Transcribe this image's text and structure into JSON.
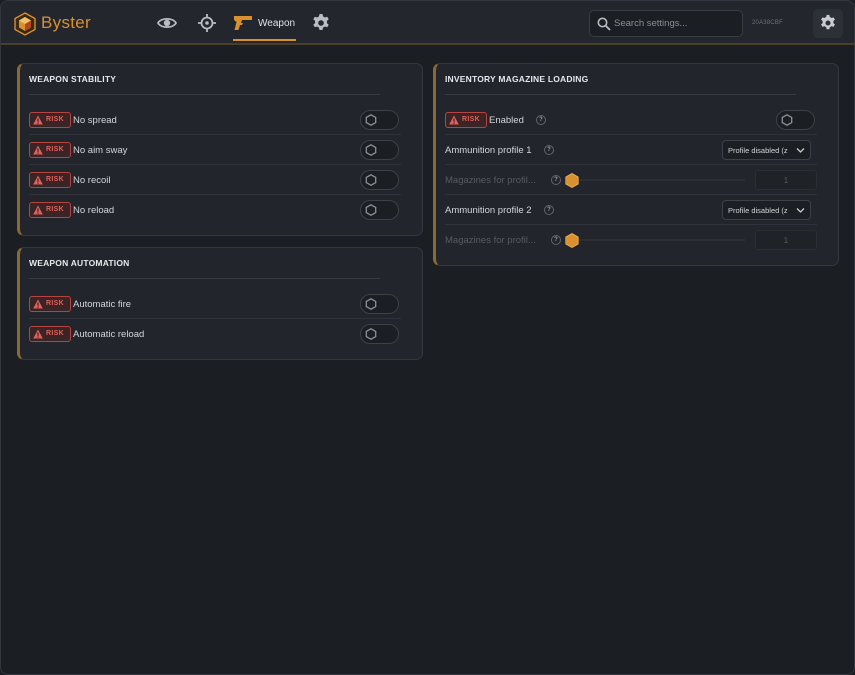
{
  "app": {
    "brand": "Byster",
    "session_code": "20A38CBF"
  },
  "nav": {
    "weapon_label": "Weapon",
    "items": [
      "visuals-eye-icon",
      "aim-crosshair-icon",
      "weapon-pistol-icon",
      "settings-gear-icon"
    ],
    "active": "Weapon"
  },
  "search": {
    "placeholder": "Search settings...",
    "value": ""
  },
  "colors": {
    "accent": "#d9902f",
    "risk": "#e0605a",
    "panel_bg": "#22252b",
    "page_bg": "#1b1e23"
  },
  "panels": {
    "weapon_stability": {
      "title": "WEAPON STABILITY",
      "rows": [
        {
          "risk": "RISK",
          "label": "No spread",
          "enabled": false
        },
        {
          "risk": "RISK",
          "label": "No aim sway",
          "enabled": false
        },
        {
          "risk": "RISK",
          "label": "No recoil",
          "enabled": false
        },
        {
          "risk": "RISK",
          "label": "No reload",
          "enabled": false
        }
      ]
    },
    "weapon_automation": {
      "title": "WEAPON AUTOMATION",
      "rows": [
        {
          "risk": "RISK",
          "label": "Automatic fire",
          "enabled": false
        },
        {
          "risk": "RISK",
          "label": "Automatic reload",
          "enabled": false
        }
      ]
    },
    "inventory_magazine_loading": {
      "title": "INVENTORY MAGAZINE LOADING",
      "enabled_row": {
        "risk": "RISK",
        "label": "Enabled",
        "help": "?",
        "enabled": false
      },
      "ammo_profile_1": {
        "label": "Ammunition profile 1",
        "help": "?",
        "selected": "Profile disabled (z"
      },
      "magazines_1": {
        "label": "Magazines for profil...",
        "help": "?",
        "value": "1",
        "slider_fraction": 0
      },
      "ammo_profile_2": {
        "label": "Ammunition profile 2",
        "help": "?",
        "selected": "Profile disabled (z"
      },
      "magazines_2": {
        "label": "Magazines for profil...",
        "help": "?",
        "value": "1",
        "slider_fraction": 0
      }
    }
  }
}
